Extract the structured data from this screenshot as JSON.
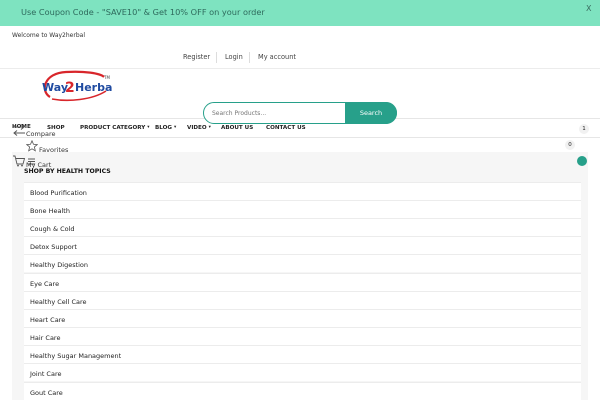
{
  "promo": {
    "text": "Use Coupon Code - \"SAVE10\" & Get 10% OFF on your order",
    "close_label": "X"
  },
  "header": {
    "welcome": "Welcome to Way2herbal",
    "links": [
      "Register",
      "Login",
      "My account"
    ],
    "logo_text": "Way2Herbal",
    "logo_tm": "TM"
  },
  "search": {
    "placeholder": "Search Products...",
    "button_label": "Search"
  },
  "nav": {
    "home_label": "HOME",
    "items": [
      {
        "label": "SHOP",
        "has_caret": false
      },
      {
        "label": "PRODUCT CATEGORY",
        "has_caret": true
      },
      {
        "label": "BLOG",
        "has_caret": true
      },
      {
        "label": "VIDEO",
        "has_caret": true
      },
      {
        "label": "ABOUT US",
        "has_caret": false
      },
      {
        "label": "CONTACT US",
        "has_caret": false
      }
    ],
    "caret": "▾"
  },
  "utilities": {
    "compare": {
      "label": "Compare",
      "count": "1",
      "icon": "compare-icon"
    },
    "favorites": {
      "label": "Favorites",
      "count": "0",
      "icon": "star-icon"
    },
    "cart": {
      "label": "My Cart",
      "count": "0",
      "icon": "cart-icon"
    }
  },
  "health_menu": {
    "heading": "SHOP BY HEALTH TOPICS",
    "items": [
      "Blood Purification",
      "Bone Health",
      "Cough & Cold",
      "Detox Support",
      "Healthy Digestion",
      "Eye Care",
      "Healthy Cell Care",
      "Heart Care",
      "Hair Care",
      "Healthy Sugar Management",
      "Joint Care",
      "Gout Care"
    ]
  },
  "colors": {
    "promo_bg": "#7ee3c0",
    "accent": "#27a08a",
    "logo_red": "#d8262b",
    "logo_blue": "#1f4aa0"
  }
}
